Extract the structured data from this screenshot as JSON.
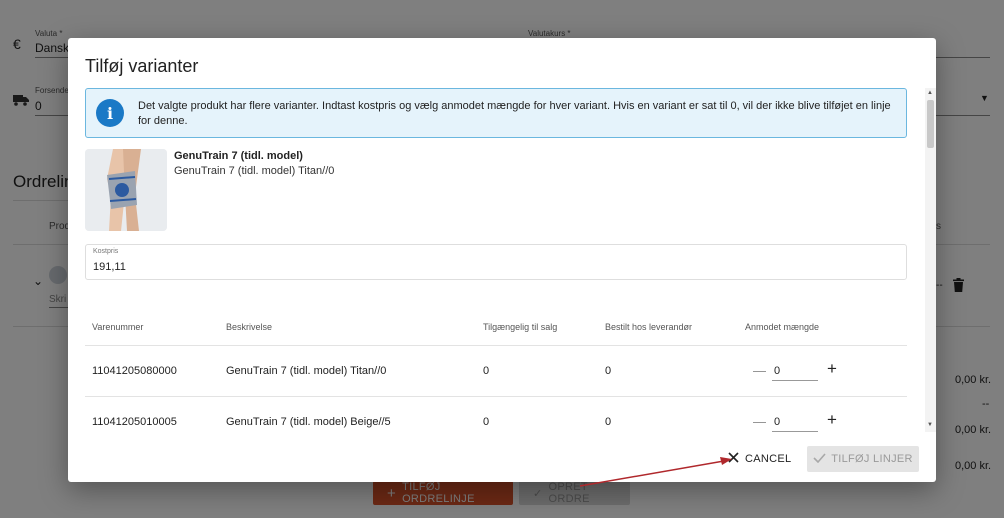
{
  "background": {
    "currency_label": "Valuta *",
    "currency_value": "Danske",
    "currency_icon": "euro-icon",
    "exchange_label": "Valutakurs *",
    "shipping_label": "Forsende",
    "shipping_value": "0",
    "shipping_icon": "truck-icon",
    "orderlines_heading": "Ordrelin",
    "product_col": "Prod",
    "s_col": "s",
    "comment_placeholder": "Skri",
    "amounts": [
      "0,00 kr.",
      "--",
      "0,00 kr.",
      "0,00 kr."
    ],
    "row_more": "--",
    "add_orderline_label": "TILFØJ ORDRELINJE",
    "create_order_label": "OPRET ORDRE",
    "accent_color": "#d9532a"
  },
  "dialog": {
    "title": "Tilføj varianter",
    "info_text": "Det valgte produkt har flere varianter. Indtast kostpris og vælg anmodet mængde for hver variant. Hvis en variant er sat til 0, vil der ikke blive tilføjet en linje for denne.",
    "info_icon": "info-icon",
    "product": {
      "name": "GenuTrain 7 (tidl. model)",
      "variant": "GenuTrain 7 (tidl. model) Titan//0"
    },
    "cost": {
      "label": "Kostpris",
      "value": "191,11"
    },
    "table": {
      "headers": [
        "Varenummer",
        "Beskrivelse",
        "Tilgængelig til salg",
        "Bestilt hos leverandør",
        "Anmodet mængde"
      ],
      "rows": [
        {
          "sku": "11041205080000",
          "description": "GenuTrain 7 (tidl. model) Titan//0",
          "available": "0",
          "ordered": "0",
          "quantity": "0"
        },
        {
          "sku": "11041205010005",
          "description": "GenuTrain 7 (tidl. model) Beige//5",
          "available": "0",
          "ordered": "0",
          "quantity": "0"
        }
      ]
    },
    "actions": {
      "cancel_label": "CANCEL",
      "add_lines_label": "TILFØJ LINJER"
    }
  },
  "annotation_arrow_color": "#b0282c"
}
